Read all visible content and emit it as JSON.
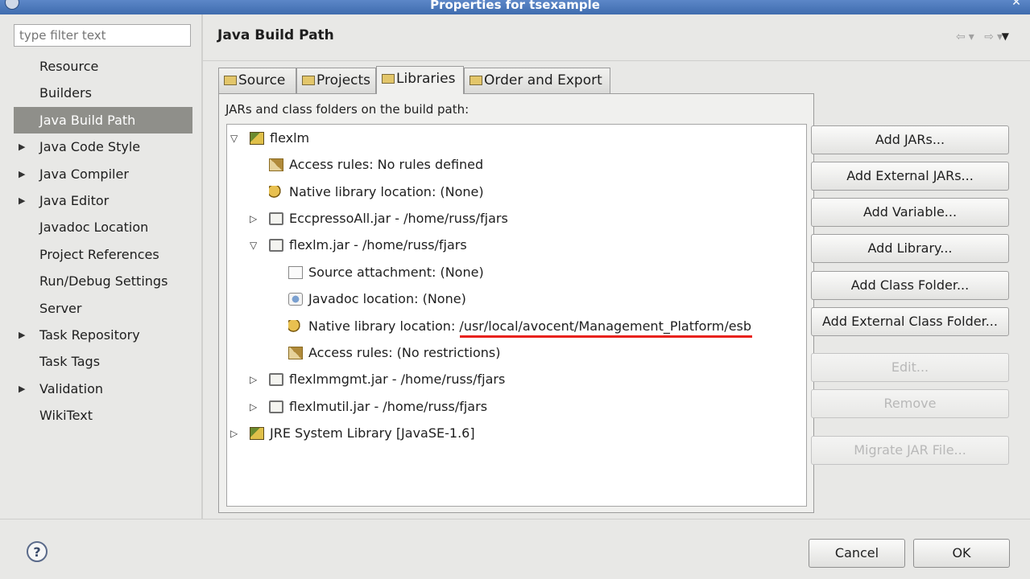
{
  "window": {
    "title": "Properties for tsexample"
  },
  "filter": {
    "placeholder": "type filter text"
  },
  "nav": [
    {
      "label": "Resource",
      "expandable": false,
      "selected": false
    },
    {
      "label": "Builders",
      "expandable": false,
      "selected": false
    },
    {
      "label": "Java Build Path",
      "expandable": false,
      "selected": true
    },
    {
      "label": "Java Code Style",
      "expandable": true,
      "selected": false
    },
    {
      "label": "Java Compiler",
      "expandable": true,
      "selected": false
    },
    {
      "label": "Java Editor",
      "expandable": true,
      "selected": false
    },
    {
      "label": "Javadoc Location",
      "expandable": false,
      "selected": false
    },
    {
      "label": "Project References",
      "expandable": false,
      "selected": false
    },
    {
      "label": "Run/Debug Settings",
      "expandable": false,
      "selected": false
    },
    {
      "label": "Server",
      "expandable": false,
      "selected": false
    },
    {
      "label": "Task Repository",
      "expandable": true,
      "selected": false
    },
    {
      "label": "Task Tags",
      "expandable": false,
      "selected": false
    },
    {
      "label": "Validation",
      "expandable": true,
      "selected": false
    },
    {
      "label": "WikiText",
      "expandable": false,
      "selected": false
    }
  ],
  "page": {
    "title": "Java Build Path"
  },
  "tabs": [
    {
      "label": "Source",
      "active": false
    },
    {
      "label": "Projects",
      "active": false
    },
    {
      "label": "Libraries",
      "active": true
    },
    {
      "label": "Order and Export",
      "active": false
    }
  ],
  "libraries": {
    "description": "JARs and class folders on the build path:",
    "tree": [
      {
        "text": "flexlm",
        "icon": "library-icon",
        "twisty": "expanded"
      },
      {
        "text": "Access rules: No rules defined",
        "icon": "access-rules-icon",
        "twisty": "none"
      },
      {
        "text": "Native library location: (None)",
        "icon": "native-library-icon",
        "twisty": "none"
      },
      {
        "text": "EccpressoAll.jar - /home/russ/fjars",
        "icon": "jar-icon",
        "twisty": "collapsed"
      },
      {
        "text": "flexlm.jar - /home/russ/fjars",
        "icon": "jar-icon",
        "twisty": "expanded"
      },
      {
        "text": "Source attachment: (None)",
        "icon": "source-attachment-icon",
        "twisty": "none"
      },
      {
        "text": "Javadoc location: (None)",
        "icon": "javadoc-icon",
        "twisty": "none"
      },
      {
        "label": "Native library location: ",
        "path": "/usr/local/avocent/Management_Platform/esb",
        "icon": "native-library-icon",
        "twisty": "none",
        "highlighted": true
      },
      {
        "text": "Access rules: (No restrictions)",
        "icon": "access-rules-icon",
        "twisty": "none"
      },
      {
        "text": "flexlmmgmt.jar - /home/russ/fjars",
        "icon": "jar-icon",
        "twisty": "collapsed"
      },
      {
        "text": "flexlmutil.jar - /home/russ/fjars",
        "icon": "jar-icon",
        "twisty": "collapsed"
      },
      {
        "text": "JRE System Library [JavaSE-1.6]",
        "icon": "library-icon",
        "twisty": "collapsed"
      }
    ],
    "highlight_color": "#e8211a"
  },
  "buttons": [
    {
      "label": "Add JARs...",
      "enabled": true
    },
    {
      "label": "Add External JARs...",
      "enabled": true
    },
    {
      "label": "Add Variable...",
      "enabled": true
    },
    {
      "label": "Add Library...",
      "enabled": true
    },
    {
      "label": "Add Class Folder...",
      "enabled": true
    },
    {
      "label": "Add External Class Folder...",
      "enabled": true
    },
    {
      "label": "Edit...",
      "enabled": false
    },
    {
      "label": "Remove",
      "enabled": false
    },
    {
      "label": "Migrate JAR File...",
      "enabled": false
    }
  ],
  "footer": {
    "help": "?",
    "cancel": "Cancel",
    "ok": "OK"
  }
}
